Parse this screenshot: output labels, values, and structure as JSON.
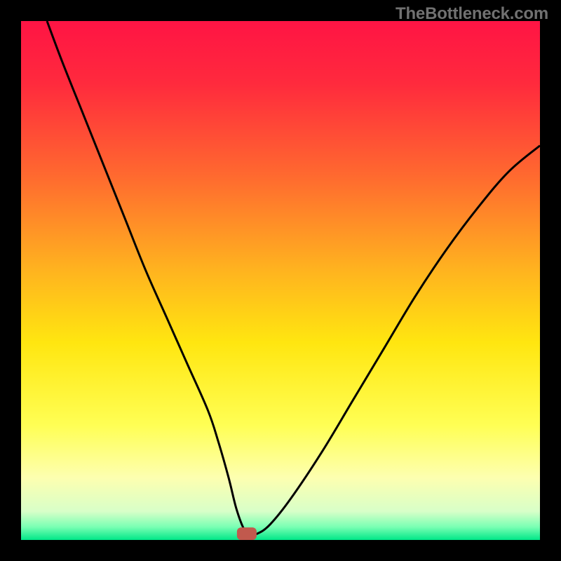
{
  "watermark": "TheBottleneck.com",
  "colors": {
    "gradient_stops": [
      {
        "offset": 0.0,
        "color": "#ff1444"
      },
      {
        "offset": 0.12,
        "color": "#ff2a3d"
      },
      {
        "offset": 0.3,
        "color": "#ff6a2f"
      },
      {
        "offset": 0.48,
        "color": "#ffb31f"
      },
      {
        "offset": 0.62,
        "color": "#ffe610"
      },
      {
        "offset": 0.78,
        "color": "#ffff55"
      },
      {
        "offset": 0.88,
        "color": "#fdffb0"
      },
      {
        "offset": 0.945,
        "color": "#d8ffc8"
      },
      {
        "offset": 0.975,
        "color": "#79ffb3"
      },
      {
        "offset": 1.0,
        "color": "#00e788"
      }
    ],
    "curve": "#000000",
    "marker": "#c1594d"
  },
  "chart_data": {
    "type": "line",
    "title": "",
    "xlabel": "",
    "ylabel": "",
    "xlim": [
      0,
      100
    ],
    "ylim": [
      0,
      100
    ],
    "marker": {
      "x": 43.5,
      "y": 1.2
    },
    "series": [
      {
        "name": "bottleneck",
        "x": [
          5,
          8,
          12,
          16,
          20,
          24,
          28,
          32,
          36,
          38,
          40,
          41.5,
          43,
          44,
          45.5,
          48,
          52,
          58,
          64,
          70,
          76,
          82,
          88,
          94,
          100
        ],
        "y": [
          100,
          92,
          82,
          72,
          62,
          52,
          43,
          34,
          25,
          19,
          12,
          6,
          2,
          1.2,
          1.2,
          3,
          8,
          17,
          27,
          37,
          47,
          56,
          64,
          71,
          76
        ]
      }
    ]
  }
}
